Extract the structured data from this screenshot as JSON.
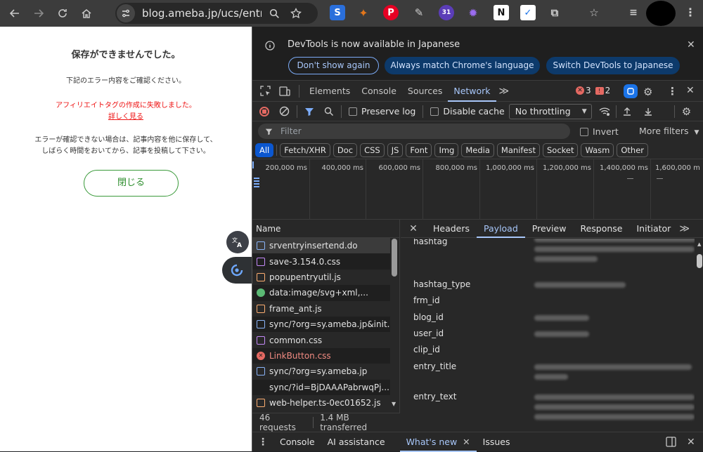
{
  "browser": {
    "url": "blog.ameba.jp/ucs/entr...",
    "extension_badge": "31"
  },
  "page": {
    "title": "保存ができませんでした。",
    "subtitle": "下記のエラー内容をご確認ください。",
    "error_message": "アフィリエイトタグの作成に失敗しました。",
    "details_link": "詳しく見る",
    "note_line1": "エラーが確認できない場合は、記事内容を他に保存して、",
    "note_line2": "しばらく時間をおいてから、記事を投稿して下さい。",
    "close_button": "閉じる"
  },
  "devtools": {
    "infobar": {
      "message": "DevTools is now available in Japanese",
      "btn_dont_show": "Don't show again",
      "btn_match": "Always match Chrome's language",
      "btn_switch": "Switch DevTools to Japanese"
    },
    "tabs": [
      "Elements",
      "Console",
      "Sources",
      "Network"
    ],
    "active_tab": "Network",
    "error_count": "3",
    "warning_count": "2",
    "toolbar": {
      "preserve_log": "Preserve log",
      "disable_cache": "Disable cache",
      "throttling": "No throttling"
    },
    "filter": {
      "placeholder": "Filter",
      "invert": "Invert",
      "more_filters": "More filters"
    },
    "types": [
      "All",
      "Fetch/XHR",
      "Doc",
      "CSS",
      "JS",
      "Font",
      "Img",
      "Media",
      "Manifest",
      "Socket",
      "Wasm",
      "Other"
    ],
    "overview_ticks": [
      "200,000 ms",
      "400,000 ms",
      "600,000 ms",
      "800,000 ms",
      "1,000,000 ms",
      "1,200,000 ms",
      "1,400,000 ms",
      "1,600,000 m"
    ],
    "requests_header": "Name",
    "requests": [
      {
        "name": "srventryinsertend.do",
        "kind": "doc"
      },
      {
        "name": "save-3.154.0.css",
        "kind": "css"
      },
      {
        "name": "popupentryutil.js",
        "kind": "js"
      },
      {
        "name": "data:image/svg+xml,...",
        "kind": "img"
      },
      {
        "name": "frame_ant.js",
        "kind": "js"
      },
      {
        "name": "sync/?org=sy.ameba.jp&init...",
        "kind": "doc"
      },
      {
        "name": "common.css",
        "kind": "css"
      },
      {
        "name": "LinkButton.css",
        "kind": "error"
      },
      {
        "name": "sync/?org=sy.ameba.jp",
        "kind": "doc"
      },
      {
        "name": "sync/?id=BjDAAAPabrwqPj...",
        "kind": "none"
      },
      {
        "name": "web-helper.ts-0ec01652.js",
        "kind": "js"
      }
    ],
    "status": {
      "requests": "46 requests",
      "transferred": "1.4 MB transferred"
    },
    "detail_tabs": [
      "Headers",
      "Payload",
      "Preview",
      "Response",
      "Initiator"
    ],
    "active_detail_tab": "Payload",
    "payload_keys": [
      "hashtag",
      "hashtag_type",
      "frm_id",
      "blog_id",
      "user_id",
      "clip_id",
      "entry_title",
      "entry_text"
    ],
    "drawer_tabs": [
      "Console",
      "AI assistance",
      "What's new",
      "Issues"
    ],
    "active_drawer_tab": "What's new"
  }
}
